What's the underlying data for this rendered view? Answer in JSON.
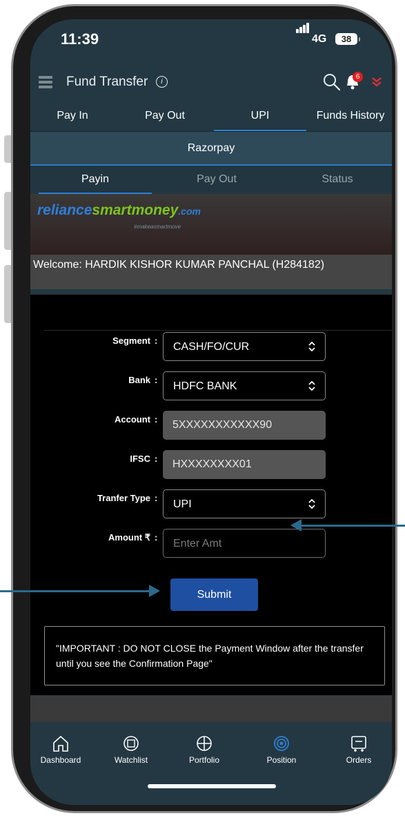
{
  "status_bar": {
    "time": "11:39",
    "network": "4G",
    "battery": "38"
  },
  "header": {
    "title": "Fund Transfer",
    "notification_count": "6"
  },
  "top_tabs": [
    {
      "label": "Pay In"
    },
    {
      "label": "Pay Out"
    },
    {
      "label": "UPI"
    },
    {
      "label": "Funds History"
    }
  ],
  "top_tabs_active": "UPI",
  "gateway_bar": {
    "label": "Razorpay"
  },
  "sub_tabs": [
    {
      "label": "Payin"
    },
    {
      "label": "Pay Out"
    },
    {
      "label": "Status"
    }
  ],
  "sub_tabs_active": "Payin",
  "brand": {
    "part1": "reliance",
    "part2": "smartmoney",
    "part3": ".com",
    "tagline": "#makeasmartmove"
  },
  "welcome": {
    "text": "Welcome: HARDIK KISHOR KUMAR PANCHAL (H284182)"
  },
  "form": {
    "colon": ":",
    "segment": {
      "label": "Segment",
      "value": "CASH/FO/CUR"
    },
    "bank": {
      "label": "Bank",
      "value": "HDFC BANK"
    },
    "account": {
      "label": "Account",
      "value": "5XXXXXXXXXXX90"
    },
    "ifsc": {
      "label": "IFSC",
      "value": "HXXXXXXXX01"
    },
    "transfer_type": {
      "label": "Tranfer Type",
      "value": "UPI"
    },
    "amount": {
      "label": "Amount ₹",
      "placeholder": "Enter Amt"
    },
    "submit_label": "Submit"
  },
  "notice": {
    "text": "\"IMPORTANT : DO NOT CLOSE the Payment Window after the transfer until you see the Confirmation Page\""
  },
  "bottom_nav": [
    {
      "label": "Dashboard",
      "icon": "home-icon"
    },
    {
      "label": "Watchlist",
      "icon": "watchlist-icon"
    },
    {
      "label": "Portfolio",
      "icon": "portfolio-icon"
    },
    {
      "label": "Position",
      "icon": "position-icon"
    },
    {
      "label": "Orders",
      "icon": "orders-icon"
    }
  ],
  "bottom_nav_active": "Position",
  "colors": {
    "accent": "#2f7fd0",
    "submit": "#1f4fa0",
    "header_bg": "#233843",
    "badge": "#e02020",
    "brand_blue": "#2f7fd6",
    "brand_green": "#7cc420",
    "annotation_arrow": "#2a6a8c"
  }
}
